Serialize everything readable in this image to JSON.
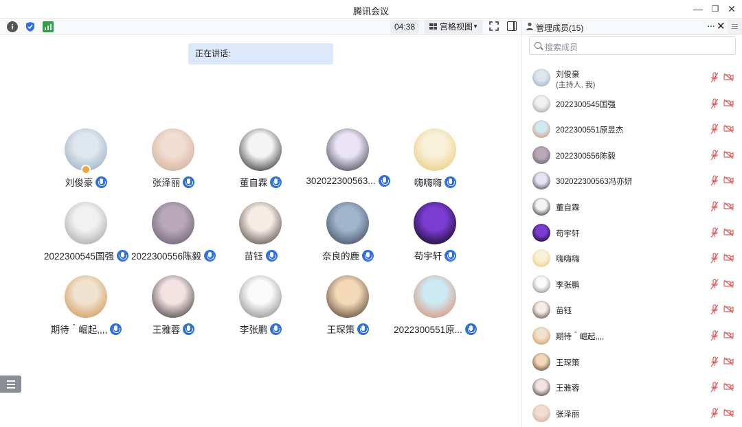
{
  "window": {
    "title": "腾讯会议",
    "minimize": "—",
    "restore": "❐",
    "close": "✕"
  },
  "toolbar": {
    "timer": "04:38",
    "view_label": "宫格视图",
    "view_caret": "▼"
  },
  "speaking_label": "正在讲话:",
  "participants": [
    {
      "name": "刘俊豪",
      "colors": [
        "#8aa3b8",
        "#dfe7ee"
      ]
    },
    {
      "name": "张泽丽",
      "colors": [
        "#c9a58f",
        "#f1ddd1"
      ]
    },
    {
      "name": "董自霖",
      "colors": [
        "#111111",
        "#f4f4f4"
      ]
    },
    {
      "name": "302022300563...",
      "colors": [
        "#2a2a3a",
        "#e9e4f3"
      ]
    },
    {
      "name": "嗨嗨嗨",
      "colors": [
        "#e8c56a",
        "#f8f0d9"
      ]
    },
    {
      "name": "2022300545国强",
      "colors": [
        "#999999",
        "#f1f1f1"
      ]
    },
    {
      "name": "2022300556陈毅",
      "colors": [
        "#5b5166",
        "#b9a9b8"
      ]
    },
    {
      "name": "苗钰",
      "colors": [
        "#3a2e2a",
        "#f6ece6"
      ]
    },
    {
      "name": "奈良的鹿",
      "colors": [
        "#2e3a4f",
        "#9fb5cc"
      ]
    },
    {
      "name": "苟宇轩",
      "colors": [
        "#000000",
        "#7a3cd1"
      ]
    },
    {
      "name": "期待＾崛起,,,,",
      "colors": [
        "#c98a3e",
        "#efe2cf"
      ]
    },
    {
      "name": "王雅蓉",
      "colors": [
        "#2a2020",
        "#f2e2e2"
      ]
    },
    {
      "name": "李张鹏",
      "colors": [
        "#777777",
        "#fafafa"
      ]
    },
    {
      "name": "王琛策",
      "colors": [
        "#3b2a1e",
        "#f4d9b8"
      ]
    },
    {
      "name": "2022300551原...",
      "colors": [
        "#e27d5a",
        "#cde9f1"
      ]
    }
  ],
  "panel": {
    "title": "管理成员(15)",
    "more": "···",
    "close": "✕",
    "search_placeholder": "搜索成员",
    "members": [
      {
        "name": "刘俊豪",
        "sub": "(主持人, 我)",
        "colors": [
          "#8aa3b8",
          "#dfe7ee"
        ]
      },
      {
        "name": "2022300545国强",
        "sub": "",
        "colors": [
          "#999999",
          "#f1f1f1"
        ]
      },
      {
        "name": "2022300551原昱杰",
        "sub": "",
        "colors": [
          "#e27d5a",
          "#cde9f1"
        ]
      },
      {
        "name": "2022300556陈毅",
        "sub": "",
        "colors": [
          "#5b5166",
          "#b9a9b8"
        ]
      },
      {
        "name": "302022300563冯亦妍",
        "sub": "",
        "colors": [
          "#2a2a3a",
          "#e9e4f3"
        ]
      },
      {
        "name": "董自霖",
        "sub": "",
        "colors": [
          "#111111",
          "#f4f4f4"
        ]
      },
      {
        "name": "苟宇轩",
        "sub": "",
        "colors": [
          "#000000",
          "#7a3cd1"
        ]
      },
      {
        "name": "嗨嗨嗨",
        "sub": "",
        "colors": [
          "#e8c56a",
          "#f8f0d9"
        ]
      },
      {
        "name": "李张鹏",
        "sub": "",
        "colors": [
          "#777777",
          "#fafafa"
        ]
      },
      {
        "name": "苗钰",
        "sub": "",
        "colors": [
          "#3a2e2a",
          "#f6ece6"
        ]
      },
      {
        "name": "期待＾崛起,,,,",
        "sub": "",
        "colors": [
          "#c98a3e",
          "#efe2cf"
        ]
      },
      {
        "name": "王琛策",
        "sub": "",
        "colors": [
          "#3b2a1e",
          "#f4d9b8"
        ]
      },
      {
        "name": "王雅蓉",
        "sub": "",
        "colors": [
          "#2a2020",
          "#f2e2e2"
        ]
      },
      {
        "name": "张泽丽",
        "sub": "",
        "colors": [
          "#c9a58f",
          "#f1ddd1"
        ]
      }
    ]
  },
  "colors": {
    "accent": "#2f6fe4",
    "speaking_bg": "#dce8fb",
    "host_badge": "#f5a23a",
    "muted_red": "#e05a5a"
  }
}
